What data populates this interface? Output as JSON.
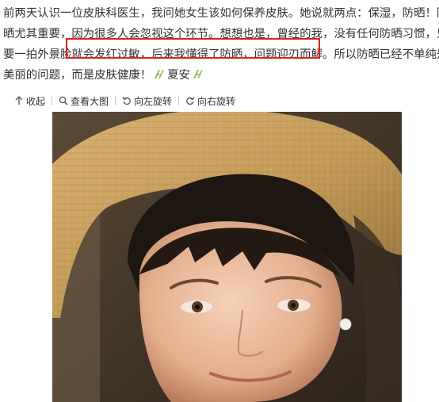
{
  "post": {
    "lines": [
      "前两天认识一位皮肤科医生，我问她女生该如何保养皮肤。她说就两点：保湿，防晒！防",
      "晒尤其重要，因为很多人会忽视这个环节。想想也是，曾经的我，没有任何防晒习惯，只",
      "要一拍外景脸就会发红过敏，后来我懂得了防晒，问题迎刃而解。所以防晒已经不单纯是"
    ],
    "last_line_text": "美丽的问题，而是皮肤健康！",
    "last_line_tail": "夏安",
    "emoji_name": "green-ribbon-emoji",
    "highlight_color": "#e0201c"
  },
  "toolbar": {
    "collapse_label": "收起",
    "view_large_label": "查看大图",
    "rotate_left_label": "向左旋转",
    "rotate_right_label": "向右旋转",
    "icons": [
      "arrow-up-icon",
      "magnifier-icon",
      "rotate-left-icon",
      "rotate-right-icon"
    ]
  },
  "photo": {
    "subject": "selfie-photo"
  }
}
